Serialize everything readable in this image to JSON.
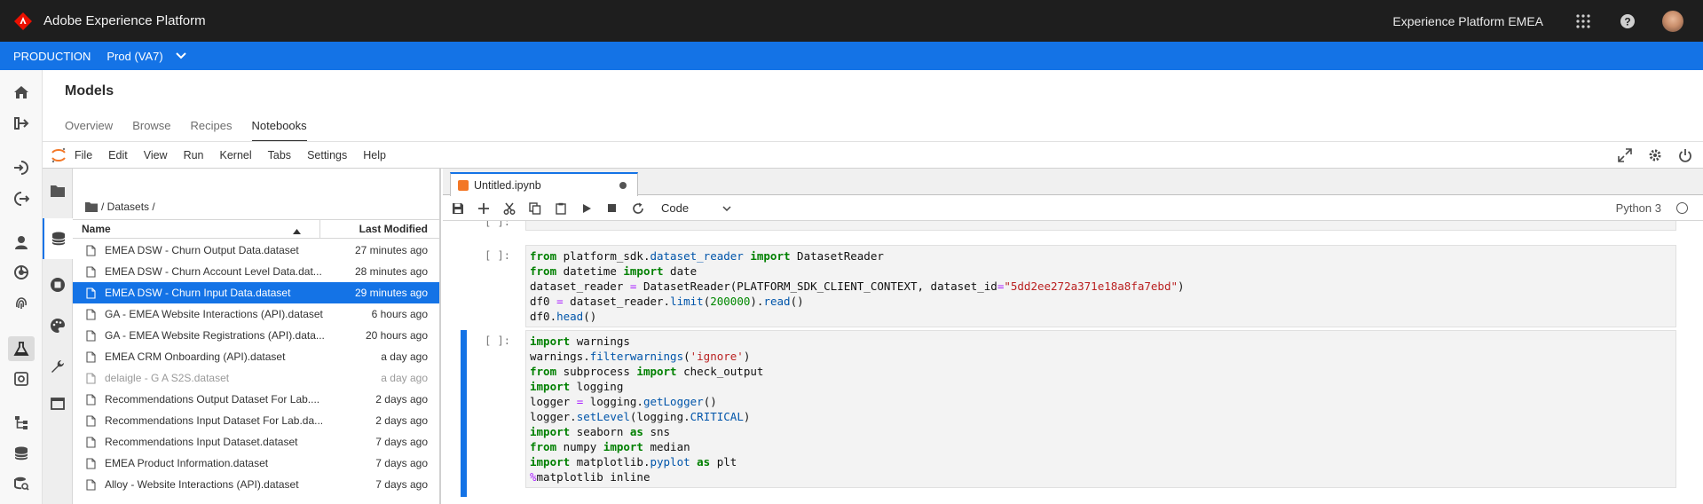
{
  "topbar": {
    "app_title": "Adobe Experience Platform",
    "org": "Experience Platform EMEA"
  },
  "envbar": {
    "environment": "PRODUCTION",
    "sandbox": "Prod (VA7)"
  },
  "page": {
    "title": "Models",
    "tabs": [
      "Overview",
      "Browse",
      "Recipes",
      "Notebooks"
    ],
    "active_tab": "Notebooks"
  },
  "jupyter_menu": [
    "File",
    "Edit",
    "View",
    "Run",
    "Kernel",
    "Tabs",
    "Settings",
    "Help"
  ],
  "file_browser": {
    "breadcrumb": "/ Datasets /",
    "col_name": "Name",
    "col_modified": "Last Modified",
    "files": [
      {
        "name": "EMEA DSW - Churn Output Data.dataset",
        "modified": "27 minutes ago",
        "state": "normal"
      },
      {
        "name": "EMEA DSW - Churn Account Level Data.dat...",
        "modified": "28 minutes ago",
        "state": "normal"
      },
      {
        "name": "EMEA DSW - Churn Input Data.dataset",
        "modified": "29 minutes ago",
        "state": "selected"
      },
      {
        "name": "GA - EMEA Website Interactions (API).dataset",
        "modified": "6 hours ago",
        "state": "normal"
      },
      {
        "name": "GA - EMEA Website Registrations (API).data...",
        "modified": "20 hours ago",
        "state": "normal"
      },
      {
        "name": "EMEA CRM Onboarding (API).dataset",
        "modified": "a day ago",
        "state": "normal"
      },
      {
        "name": "delaigle - G A S2S.dataset",
        "modified": "a day ago",
        "state": "dim"
      },
      {
        "name": "Recommendations Output Dataset For Lab....",
        "modified": "2 days ago",
        "state": "normal"
      },
      {
        "name": "Recommendations Input Dataset For Lab.da...",
        "modified": "2 days ago",
        "state": "normal"
      },
      {
        "name": "Recommendations Input Dataset.dataset",
        "modified": "7 days ago",
        "state": "normal"
      },
      {
        "name": "EMEA Product Information.dataset",
        "modified": "7 days ago",
        "state": "normal"
      },
      {
        "name": "Alloy - Website Interactions (API).dataset",
        "modified": "7 days ago",
        "state": "normal"
      }
    ]
  },
  "notebook": {
    "tab_name": "Untitled.ipynb",
    "cell_type": "Code",
    "kernel": "Python 3",
    "cells": [
      {
        "prompt": "[ ]:",
        "code": ""
      },
      {
        "prompt": "[ ]:",
        "code": "dataset_reader"
      },
      {
        "prompt": "[ ]:",
        "code": "warnings"
      }
    ]
  },
  "colors": {
    "accent": "#1473e6",
    "topbar": "#1e1e1e",
    "adobe_red": "#eb1000"
  }
}
